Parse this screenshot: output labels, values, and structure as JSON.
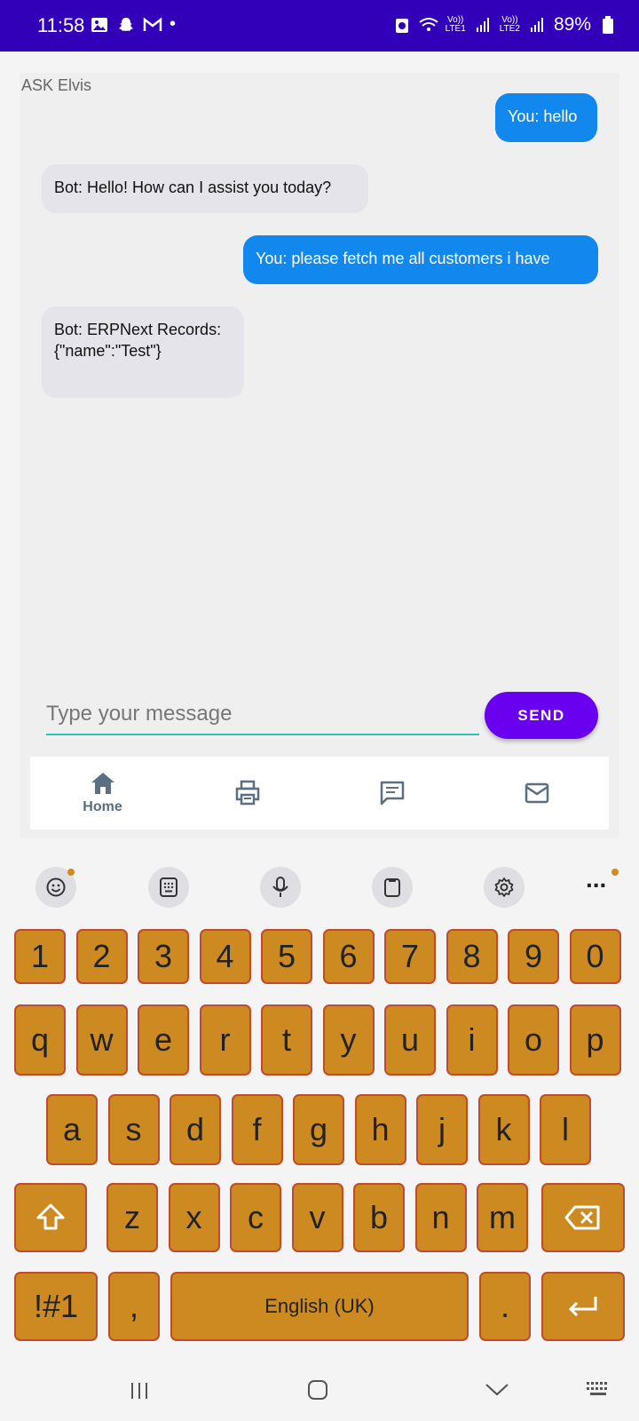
{
  "status_bar": {
    "time": "11:58",
    "battery": "89%",
    "sim1_label_top": "Vo))",
    "sim1_label_bottom": "LTE1",
    "sim2_label_top": "Vo))",
    "sim2_label_bottom": "LTE2",
    "dot": "•"
  },
  "app": {
    "title": "ASK Elvis"
  },
  "messages": [
    {
      "from": "user",
      "text": "You: hello"
    },
    {
      "from": "bot",
      "text": "Bot: Hello! How can I assist you today?"
    },
    {
      "from": "user",
      "text": "You: please fetch me all customers i have"
    },
    {
      "from": "bot",
      "text": "Bot: ERPNext Records:\n{\"name\":\"Test\"}"
    }
  ],
  "composer": {
    "placeholder": "Type your message",
    "send_label": "SEND"
  },
  "bottom_nav": {
    "items": [
      {
        "icon": "home-icon",
        "label": "Home"
      },
      {
        "icon": "printer-icon",
        "label": ""
      },
      {
        "icon": "chat-icon",
        "label": ""
      },
      {
        "icon": "mail-icon",
        "label": ""
      }
    ]
  },
  "keyboard": {
    "toolbar": [
      "emoji-icon",
      "keypad-icon",
      "mic-icon",
      "clipboard-icon",
      "settings-icon",
      "more-icon"
    ],
    "row_numbers": [
      "1",
      "2",
      "3",
      "4",
      "5",
      "6",
      "7",
      "8",
      "9",
      "0"
    ],
    "row_top": [
      "q",
      "w",
      "e",
      "r",
      "t",
      "y",
      "u",
      "i",
      "o",
      "p"
    ],
    "row_home": [
      "a",
      "s",
      "d",
      "f",
      "g",
      "h",
      "j",
      "k",
      "l"
    ],
    "row_bottom": [
      "z",
      "x",
      "c",
      "v",
      "b",
      "n",
      "m"
    ],
    "symbols_label": "!#1",
    "comma_label": ",",
    "space_label": "English (UK)",
    "period_label": ".",
    "more_label": "..."
  },
  "colors": {
    "status_bar": "#3200b8",
    "user_bubble": "#1188ee",
    "bot_bubble": "#e4e4ea",
    "send_button": "#6a00f0",
    "input_underline": "#2ec0b0",
    "key_fill": "#cd8a20",
    "key_border": "#c24a2e"
  }
}
